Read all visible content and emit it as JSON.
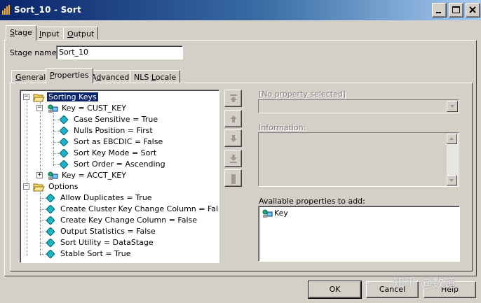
{
  "window": {
    "title": "Sort_10 - Sort"
  },
  "outer_tabs": [
    {
      "label": "Stage",
      "accel": "S",
      "rest": "tage"
    },
    {
      "label": "Input",
      "accel": "I",
      "rest": "nput"
    },
    {
      "label": "Output",
      "accel": "O",
      "rest": "utput"
    }
  ],
  "stage_name": {
    "label": "Stage name:",
    "value": "Sort_10"
  },
  "inner_tabs": [
    {
      "label": "General",
      "accel": "G",
      "rest": "eneral"
    },
    {
      "label": "Properties",
      "accel": "P",
      "rest": "roperties"
    },
    {
      "label": "Advanced",
      "pre": "A",
      "accel": "d",
      "rest": "vanced"
    },
    {
      "label": "NLS Locale",
      "pre": "NLS ",
      "accel": "L",
      "rest": "ocale"
    }
  ],
  "tree": {
    "sorting_keys": "Sorting Keys",
    "key_cust": "Key = CUST_KEY",
    "cust_props": [
      "Case Sensitive = True",
      "Nulls Position = First",
      "Sort as EBCDIC = False",
      "Sort Key Mode = Sort",
      "Sort Order = Ascending"
    ],
    "key_acct": "Key = ACCT_KEY",
    "options": "Options",
    "option_props": [
      "Allow Duplicates = True",
      "Create Cluster Key Change Column = False",
      "Create Key Change Column = False",
      "Output Statistics = False",
      "Sort Utility = DataStage",
      "Stable Sort = True"
    ]
  },
  "property_combo": {
    "placeholder": "[No property selected]"
  },
  "information": {
    "label": "Information:"
  },
  "available": {
    "label": "Available properties to add:",
    "items": [
      "Key"
    ]
  },
  "buttons": {
    "ok": "OK",
    "cancel": "Cancel",
    "help": "Help"
  },
  "watermark": "知乎 @数道",
  "colors": {
    "selection": "#0a246a",
    "face": "#d4d0c8",
    "diamond": "#19b5c8"
  }
}
